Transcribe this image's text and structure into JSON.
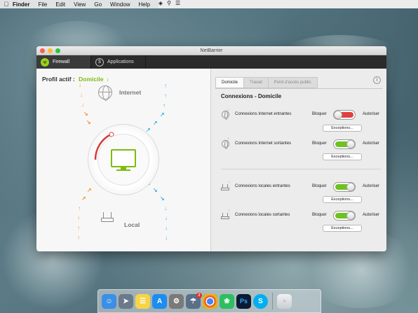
{
  "menubar": {
    "items": [
      "Finder",
      "File",
      "Edit",
      "View",
      "Go",
      "Window",
      "Help"
    ]
  },
  "window": {
    "title": "NetBarrier",
    "toolbar": {
      "tabs": [
        {
          "label": "Firewall",
          "icon": "firewall-icon"
        },
        {
          "label": "Applications",
          "icon": "applications-icon"
        }
      ]
    },
    "left": {
      "profile_label": "Profil actif :",
      "profile_value": "Domicile",
      "internet_label": "Internet",
      "local_label": "Local"
    },
    "right": {
      "tabs": [
        "Domicile",
        "Travail",
        "Point d'accès public"
      ],
      "section_title": "Connexions - Domicile",
      "rows": [
        {
          "label": "Connexions Internet entrantes",
          "block": "Bloquer",
          "allow": "Autoriser",
          "state": "blocked",
          "button": "Exceptions..."
        },
        {
          "label": "Connexions Internet sortantes",
          "block": "Bloquer",
          "allow": "Autoriser",
          "state": "allowed",
          "button": "Exceptions..."
        },
        {
          "label": "Connexions locales entrantes",
          "block": "Bloquer",
          "allow": "Autoriser",
          "state": "allowed",
          "button": "Exceptions..."
        },
        {
          "label": "Connexions locales sortantes",
          "block": "Bloquer",
          "allow": "Autoriser",
          "state": "allowed",
          "button": "Exceptions..."
        }
      ]
    }
  },
  "dock": {
    "badge": "2",
    "apps": [
      {
        "name": "finder-icon",
        "color": "#3b8fe6"
      },
      {
        "name": "launchpad-icon",
        "color": "#6b7a8a"
      },
      {
        "name": "notes-icon",
        "color": "#f5d547"
      },
      {
        "name": "app-store-icon",
        "color": "#1d8cf0"
      },
      {
        "name": "system-preferences-icon",
        "color": "#7a7a7a"
      },
      {
        "name": "netbarrier-icon",
        "color": "#5a6f88"
      },
      {
        "name": "chrome-icon",
        "color": "#e94235"
      },
      {
        "name": "evernote-icon",
        "color": "#2dbe60"
      },
      {
        "name": "photoshop-icon",
        "color": "#0a1c33"
      },
      {
        "name": "skype-icon",
        "color": "#00aff0"
      },
      {
        "name": "trash-icon",
        "color": "#d8dde0"
      }
    ]
  }
}
